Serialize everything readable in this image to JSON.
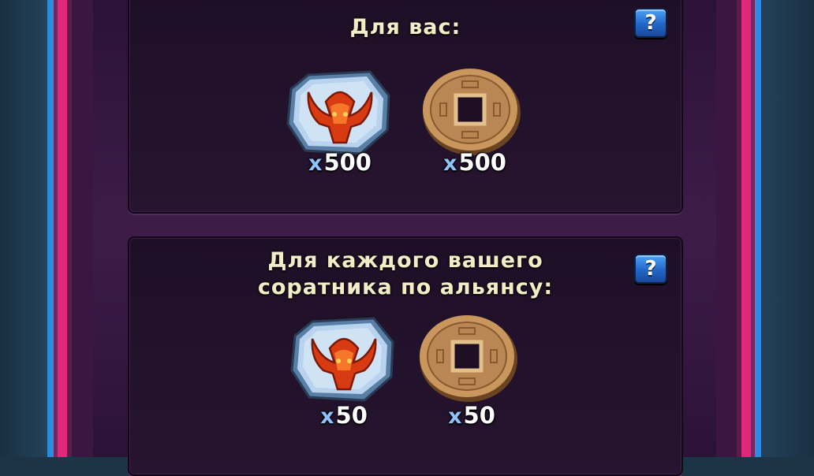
{
  "sections": [
    {
      "title_lines": [
        "Для вас:"
      ],
      "help_label": "?",
      "rewards": [
        {
          "icon": "bull-emblem-token-icon",
          "prefix": "x",
          "count": "500"
        },
        {
          "icon": "bronze-coin-icon",
          "prefix": "x",
          "count": "500"
        }
      ]
    },
    {
      "title_lines": [
        "Для каждого вашего",
        "соратника по альянсу:"
      ],
      "help_label": "?",
      "rewards": [
        {
          "icon": "bull-emblem-token-icon",
          "prefix": "x",
          "count": "50"
        },
        {
          "icon": "bronze-coin-icon",
          "prefix": "x",
          "count": "50"
        }
      ]
    }
  ],
  "colors": {
    "title": "#f3ecc6",
    "count_prefix": "#8ec3ff",
    "frame_pink": "#e0277a",
    "frame_blue": "#2d8be0"
  }
}
